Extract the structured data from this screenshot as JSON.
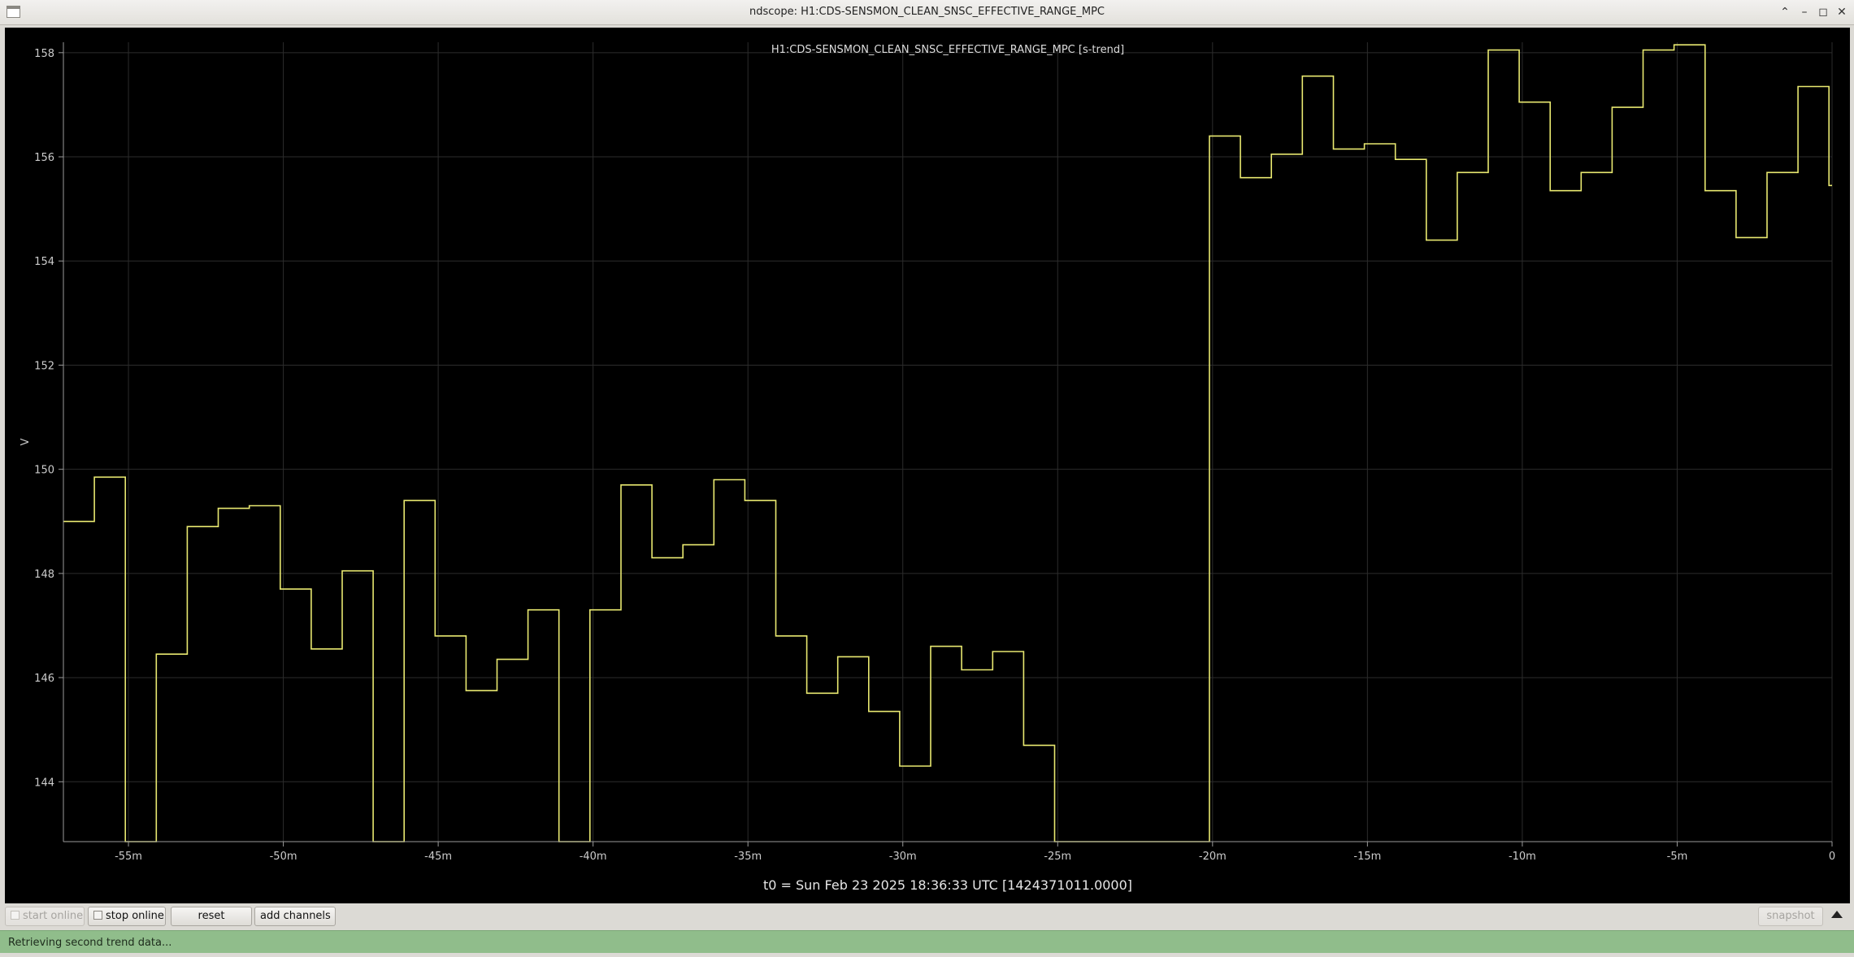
{
  "window": {
    "title": "ndscope: H1:CDS-SENSMON_CLEAN_SNSC_EFFECTIVE_RANGE_MPC",
    "controls": [
      "chevron-up-icon",
      "minimize-icon",
      "maximize-icon",
      "close-icon"
    ]
  },
  "toolbar": {
    "start_online": "start online",
    "stop_online": "stop online",
    "reset": "reset",
    "add_channels": "add channels",
    "snapshot": "snapshot"
  },
  "status": {
    "message": "Retrieving second trend data..."
  },
  "colors": {
    "trace": "#e8e870",
    "plot_background": "#000000",
    "axis": "#9a9a9a",
    "grid": "#2c2c2c",
    "status_bar": "#90bd8b"
  },
  "chart_data": {
    "type": "line",
    "step": true,
    "title": "H1:CDS-SENSMON_CLEAN_SNSC_EFFECTIVE_RANGE_MPC [s-trend]",
    "xlabel": "t0 = Sun Feb 23 2025 18:36:33 UTC [1424371011.0000]",
    "ylabel": "V",
    "x_unit": "minutes",
    "xlim": [
      -57.1,
      0
    ],
    "ylim": [
      142.85,
      158.2
    ],
    "grid": true,
    "x_ticks": [
      -55,
      -50,
      -45,
      -40,
      -35,
      -30,
      -25,
      -20,
      -15,
      -10,
      -5,
      0
    ],
    "x_tick_labels": [
      "-55m",
      "-50m",
      "-45m",
      "-40m",
      "-35m",
      "-30m",
      "-25m",
      "-20m",
      "-15m",
      "-10m",
      "-5m",
      "0"
    ],
    "y_ticks": [
      144,
      146,
      148,
      150,
      152,
      154,
      156,
      158
    ],
    "y_tick_labels": [
      "144",
      "146",
      "148",
      "150",
      "152",
      "154",
      "156",
      "158"
    ],
    "series": [
      {
        "x": [
          -57.1,
          -56.1,
          -55.1,
          -54.1,
          -53.1,
          -52.1,
          -51.1,
          -50.1,
          -49.1,
          -48.1,
          -47.1,
          -46.1,
          -45.1,
          -44.1,
          -43.1,
          -42.1,
          -41.1,
          -40.1,
          -39.1,
          -38.1,
          -37.1,
          -36.1,
          -35.1,
          -34.1,
          -33.1,
          -32.1,
          -31.1,
          -30.1,
          -29.1,
          -28.1,
          -27.1,
          -26.1,
          -25.1,
          -24.1,
          -23.1,
          -22.1,
          -21.1,
          -20.1,
          -19.1,
          -18.1,
          -17.1,
          -16.1,
          -15.1,
          -14.1,
          -13.1,
          -12.1,
          -11.1,
          -10.1,
          -9.1,
          -8.1,
          -7.1,
          -6.1,
          -5.1,
          -4.1,
          -3.1,
          -2.1,
          -1.1,
          -0.1
        ],
        "y": [
          149.0,
          149.85,
          142.85,
          146.45,
          148.9,
          149.25,
          149.3,
          147.7,
          146.55,
          148.05,
          142.85,
          149.4,
          146.8,
          145.75,
          146.35,
          147.3,
          142.85,
          147.3,
          149.7,
          148.3,
          148.55,
          149.8,
          149.4,
          146.8,
          145.7,
          146.4,
          145.35,
          144.3,
          146.6,
          146.15,
          146.5,
          144.7,
          142.85,
          142.85,
          142.85,
          142.85,
          142.85,
          156.4,
          155.6,
          156.05,
          157.55,
          156.15,
          156.25,
          155.95,
          154.4,
          155.7,
          158.05,
          157.05,
          155.35,
          155.7,
          156.95,
          158.05,
          158.15,
          155.35,
          154.45,
          155.7,
          157.35,
          155.45
        ]
      }
    ]
  }
}
